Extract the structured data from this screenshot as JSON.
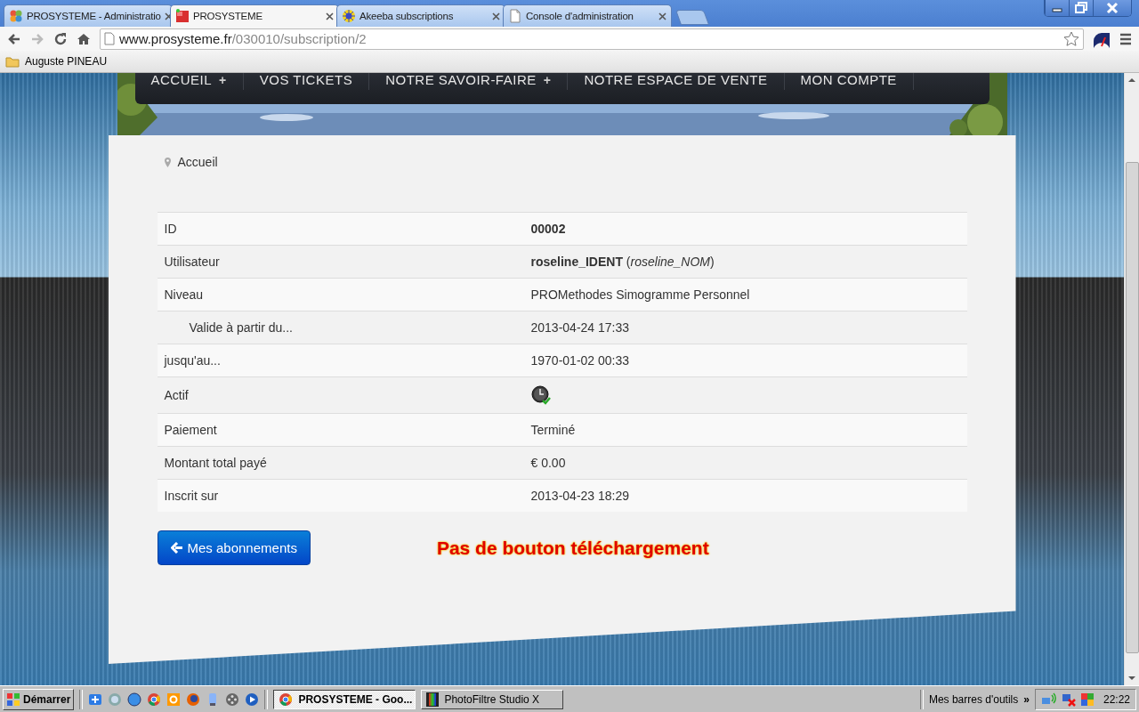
{
  "browser": {
    "tabs": [
      {
        "title": "PROSYSTEME - Administratio",
        "selected": false
      },
      {
        "title": "PROSYSTEME",
        "selected": true
      },
      {
        "title": "Akeeba subscriptions",
        "selected": false
      },
      {
        "title": "Console d'administration",
        "selected": false
      }
    ],
    "url": {
      "domain": "www.prosysteme.fr",
      "path": "/030010/subscription/2"
    },
    "bookmarks": [
      "Auguste PINEAU"
    ]
  },
  "site": {
    "menu": [
      {
        "label": "ACCUEIL",
        "submenu_mark": "+"
      },
      {
        "label": "VOS TICKETS"
      },
      {
        "label": "NOTRE SAVOIR-FAIRE",
        "submenu_mark": "+"
      },
      {
        "label": "NOTRE ESPACE DE VENTE"
      },
      {
        "label": "MON COMPTE"
      }
    ],
    "breadcrumb": "Accueil",
    "details": [
      {
        "kind": "text",
        "label": "ID",
        "value": "00002",
        "strong": true,
        "indented": false
      },
      {
        "kind": "text",
        "label": "Utilisateur",
        "value": "**roseline_IDENT** (*roseline_NOM*)",
        "strong": false,
        "indented": false
      },
      {
        "kind": "text",
        "label": "Niveau",
        "value": "PROMethodes Simogramme Personnel",
        "strong": false,
        "indented": false
      },
      {
        "kind": "text",
        "label": "Valide à partir du...",
        "value": "2013-04-24 17:33",
        "strong": false,
        "indented": true
      },
      {
        "kind": "text",
        "label": "jusqu'au...",
        "value": "1970-01-02 00:33",
        "strong": false,
        "indented": false
      },
      {
        "kind": "status",
        "label": "Actif",
        "active": true,
        "indented": false
      },
      {
        "kind": "text",
        "label": "Paiement",
        "value": "Terminé",
        "strong": false,
        "indented": false
      },
      {
        "kind": "text",
        "label": "Montant total payé",
        "value": "€ 0.00",
        "strong": false,
        "indented": false
      },
      {
        "kind": "text",
        "label": "Inscrit sur",
        "value": "2013-04-23 18:29",
        "strong": false,
        "indented": false
      }
    ],
    "back_button": "Mes abonnements",
    "annotation": "Pas de bouton téléchargement"
  },
  "taskbar": {
    "start": "Démarrer",
    "windows": [
      {
        "title": "PROSYSTEME - Goo...",
        "selected": true
      },
      {
        "title": "PhotoFiltre Studio X",
        "selected": false
      }
    ],
    "toolbars": "Mes barres d'outils",
    "chevron": "»",
    "clock": "22:22"
  }
}
